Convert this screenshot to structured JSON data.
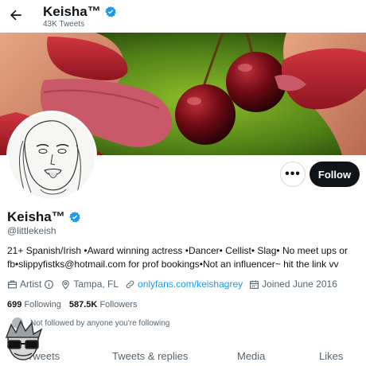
{
  "header": {
    "name": "Keisha™",
    "tweet_count": "43K Tweets"
  },
  "actions": {
    "more": "•••",
    "follow": "Follow"
  },
  "profile": {
    "name": "Keisha™",
    "handle": "@littlekeish",
    "bio": "21+ Spanish/Irish •Award winning actress •Dancer• Cellist• Slag• No meet ups or fb•slippyfistks@hotmail.com for prof bookings•Not an influencer~ hit the link vv",
    "category": "Artist",
    "location": "Tampa, FL",
    "website": "onlyfans.com/keishagrey",
    "joined": "Joined June 2016"
  },
  "stats": {
    "following_count": "699",
    "following_label": "Following",
    "followers_count": "587.5K",
    "followers_label": "Followers"
  },
  "followed_by": "Not followed by anyone you're following",
  "tabs": [
    "Tweets",
    "Tweets & replies",
    "Media",
    "Likes"
  ],
  "colors": {
    "verified": "#1d9bf0",
    "link": "#1d9bf0",
    "follow_bg": "#0f1419"
  }
}
